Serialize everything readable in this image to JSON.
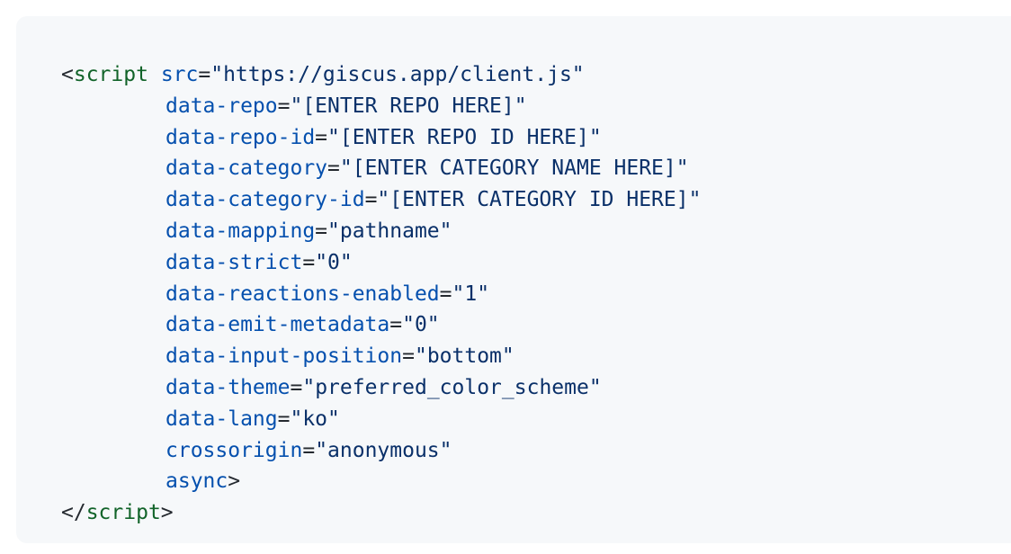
{
  "code": {
    "open_bracket": "<",
    "close_bracket": ">",
    "end_open": "</",
    "tag_name": "script",
    "first_attr": {
      "name": "src",
      "value": "\"https://giscus.app/client.js\""
    },
    "attrs": [
      {
        "name": "data-repo",
        "value": "\"[ENTER REPO HERE]\""
      },
      {
        "name": "data-repo-id",
        "value": "\"[ENTER REPO ID HERE]\""
      },
      {
        "name": "data-category",
        "value": "\"[ENTER CATEGORY NAME HERE]\""
      },
      {
        "name": "data-category-id",
        "value": "\"[ENTER CATEGORY ID HERE]\""
      },
      {
        "name": "data-mapping",
        "value": "\"pathname\""
      },
      {
        "name": "data-strict",
        "value": "\"0\""
      },
      {
        "name": "data-reactions-enabled",
        "value": "\"1\""
      },
      {
        "name": "data-emit-metadata",
        "value": "\"0\""
      },
      {
        "name": "data-input-position",
        "value": "\"bottom\""
      },
      {
        "name": "data-theme",
        "value": "\"preferred_color_scheme\""
      },
      {
        "name": "data-lang",
        "value": "\"ko\""
      },
      {
        "name": "crossorigin",
        "value": "\"anonymous\""
      }
    ],
    "last_attr": "async",
    "equals": "="
  },
  "colors": {
    "background": "#f6f8fa",
    "tag": "#116329",
    "attr_name": "#0550ae",
    "string": "#0a3069",
    "punct": "#24292f"
  }
}
